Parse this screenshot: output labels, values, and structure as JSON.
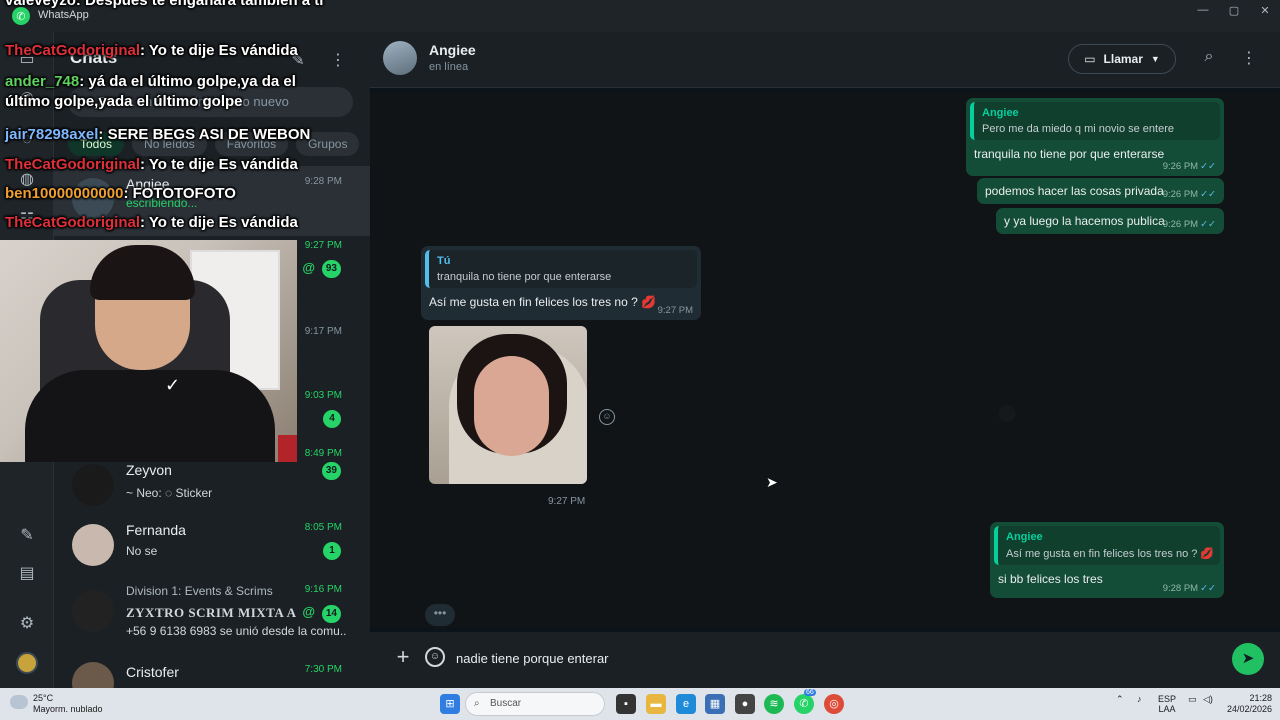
{
  "window": {
    "title": "WhatsApp",
    "minimize": "—",
    "maximize": "▢",
    "close": "✕"
  },
  "chatlist": {
    "title": "Chats",
    "search_placeholder": "Busca un chat o inicia uno nuevo",
    "filters": [
      "Todos",
      "No leídos",
      "Favoritos",
      "Grupos"
    ],
    "items": [
      {
        "name": "Angiee",
        "preview": "escribiendo...",
        "time": "9:28 PM"
      },
      {
        "name": "",
        "preview": "",
        "time": "9:27 PM",
        "badge": "93",
        "mention": "@"
      },
      {
        "name": "",
        "preview": "",
        "time": "9:17 PM"
      },
      {
        "name": "",
        "preview": "",
        "time": "9:03 PM",
        "badge": "4"
      },
      {
        "name": "",
        "preview": "",
        "time": "8:49 PM"
      },
      {
        "name": "Zeyvon",
        "preview": "~ Neo: ◌ Sticker",
        "badge": "39"
      },
      {
        "name": "Fernanda",
        "preview": "No se",
        "time": "8:05 PM",
        "badge": "1"
      },
      {
        "name": "Division 1: Events & Scrims",
        "preview": "ZYXTRO SCRIM MIXTA A...",
        "preview2": "+56 9 6138 6983 se unió desde la comu...",
        "time": "9:16 PM",
        "badge": "14",
        "mention": "@"
      },
      {
        "name": "Cristofer",
        "preview": "",
        "time": "7:30 PM"
      }
    ]
  },
  "stream_chat": [
    {
      "user": "valeveyzo",
      "user_color": "#ffffff",
      "text": ": Despues te engañara tambien a ti"
    },
    {
      "user": "TheCatGodoriginal",
      "user_color": "#e0303a",
      "text": ": Yo te dije Es vándida"
    },
    {
      "user": "ander_748",
      "user_color": "#5fd35f",
      "text": ": yá da el último golpe,ya da el último golpe,yada el último golpe"
    },
    {
      "user": "jair78298axel",
      "user_color": "#7fb8ff",
      "text": ": SERE BEGS ASI DE WEBON"
    },
    {
      "user": "TheCatGodoriginal",
      "user_color": "#e0303a",
      "text": ": Yo te dije Es vándida"
    },
    {
      "user": "ben10000000000",
      "user_color": "#f0a030",
      "text": ": FOTOTOFOTO"
    },
    {
      "user": "TheCatGodoriginal",
      "user_color": "#e0303a",
      "text": ": Yo te dije Es vándida"
    }
  ],
  "conversation": {
    "contact_name": "Angiee",
    "status": "en línea",
    "call_label": "Llamar",
    "messages": [
      {
        "dir": "out",
        "quote_name": "Angiee",
        "quote_text": "Pero me da miedo q mi novio se entere",
        "text": "tranquila no tiene por que enterarse",
        "time": "9:26 PM"
      },
      {
        "dir": "out",
        "text": "podemos hacer las cosas privada",
        "time": "9:26 PM"
      },
      {
        "dir": "out",
        "text": "y ya luego la hacemos publica",
        "time": "9:26 PM"
      },
      {
        "dir": "in",
        "quote_name": "Tú",
        "quote_text": "tranquila no tiene por que enterarse",
        "text": "Así me gusta en fin felices los tres no ? 💋",
        "time": "9:27 PM"
      },
      {
        "dir": "in",
        "type": "image",
        "time": "9:27 PM"
      },
      {
        "dir": "out",
        "quote_name": "Angiee",
        "quote_text": "Así me gusta en fin felices los tres no ? 💋",
        "text": "si bb felices los tres",
        "time": "9:28 PM"
      }
    ],
    "typing_indicator": "•••",
    "composer_value": "nadie tiene porque enterar"
  },
  "taskbar": {
    "weather_temp": "25°C",
    "weather_desc": "Mayorm. nublado",
    "search_label": "Buscar",
    "lang_top": "ESP",
    "lang_bottom": "LAA",
    "time": "21:28",
    "date": "24/02/2026",
    "whatsapp_badge": "66"
  },
  "colors": {
    "accent": "#25d366",
    "outgoing_bubble": "#144d37",
    "incoming_bubble": "#202c33",
    "send_button": "#21c063"
  }
}
